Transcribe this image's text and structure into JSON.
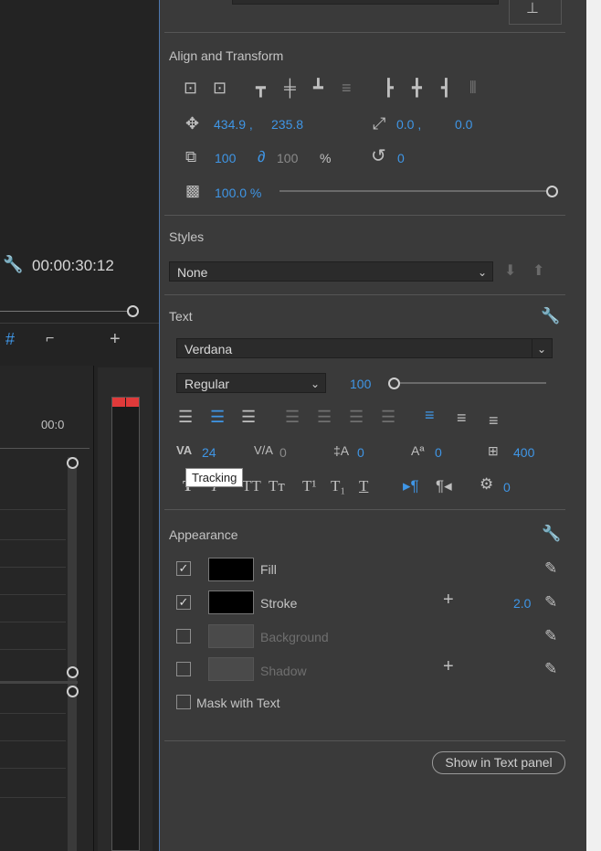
{
  "left": {
    "timecode": "00:00:30:12",
    "ruler_label": "00:0"
  },
  "align": {
    "title": "Align and Transform",
    "position_x": "434.9 ,",
    "position_y": "235.8",
    "anchor_x": "0.0 ,",
    "anchor_y": "0.0",
    "scale": "100",
    "scale_linked": "100",
    "percent": "%",
    "rotation": "0",
    "opacity": "100.0 %"
  },
  "styles": {
    "title": "Styles",
    "value": "None"
  },
  "text": {
    "title": "Text",
    "font": "Verdana",
    "style": "Regular",
    "size": "100",
    "tracking": "24",
    "kerning": "0",
    "leading": "0",
    "baseline": "0",
    "tsume": "400",
    "tab_value": "0",
    "tooltip": "Tracking"
  },
  "appearance": {
    "title": "Appearance",
    "fill_label": "Fill",
    "stroke_label": "Stroke",
    "stroke_width": "2.0",
    "background_label": "Background",
    "shadow_label": "Shadow",
    "mask_label": "Mask with Text",
    "fill_color": "#000000",
    "stroke_color": "#000000"
  },
  "footer": {
    "show_button": "Show in Text panel"
  },
  "colors": {
    "accent": "#3f96e6",
    "panel_bg": "#3a3a3a",
    "meter_red": "#e03a3a"
  }
}
